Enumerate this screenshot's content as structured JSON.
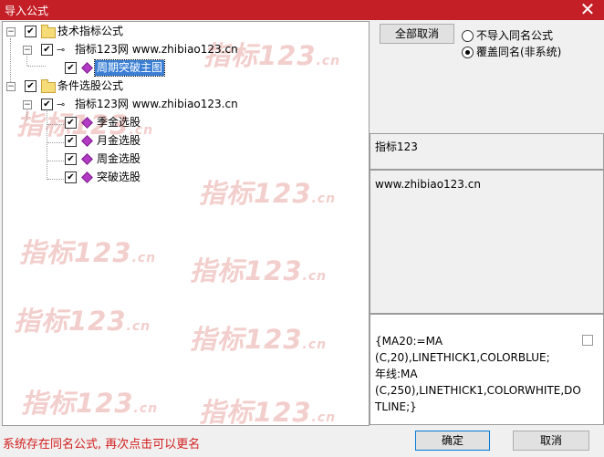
{
  "window": {
    "title": "导入公式",
    "close_glyph": "✕"
  },
  "tree": {
    "nodes": [
      {
        "label": "技术指标公式"
      },
      {
        "label": "指标123网 www.zhibiao123.cn"
      },
      {
        "label": "周期突破主图"
      },
      {
        "label": "条件选股公式"
      },
      {
        "label": "指标123网 www.zhibiao123.cn"
      },
      {
        "label": "季金选股"
      },
      {
        "label": "月金选股"
      },
      {
        "label": "周金选股"
      },
      {
        "label": "突破选股"
      }
    ],
    "check_glyph": "✔",
    "minus_glyph": "−"
  },
  "watermark": {
    "text": "指标123",
    "suffix": ".cn"
  },
  "options": {
    "deselect_all": "全部取消",
    "no_import_same": "不导入同名公式",
    "overwrite_same": "覆盖同名(非系统)"
  },
  "info": {
    "name": "指标123",
    "description": "www.zhibiao123.cn",
    "code_lines": [
      "{MA20:=MA",
      "(C,20),LINETHICK1,COLORBLUE;",
      "年线:MA",
      "(C,250),LINETHICK1,COLORWHITE,DO",
      "TLINE;}"
    ]
  },
  "status": "系统存在同名公式, 再次点击可以更名",
  "buttons": {
    "ok": "确定",
    "cancel": "取消"
  },
  "colors": {
    "title_bar": "#c41e26",
    "selection": "#3b7fd5",
    "status_text": "#d41e1e"
  }
}
